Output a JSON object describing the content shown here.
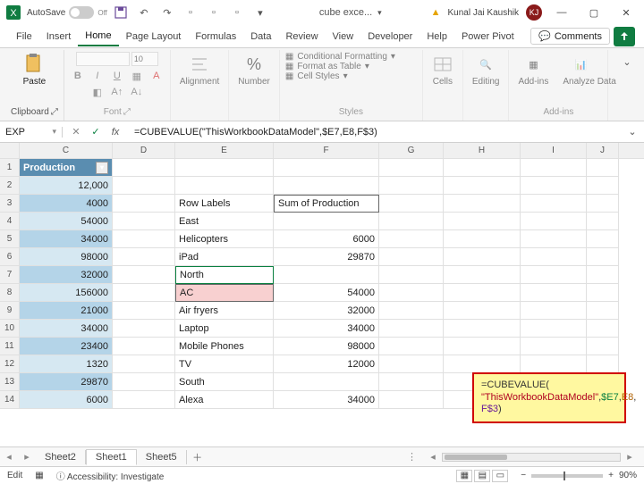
{
  "titlebar": {
    "autosave_label": "AutoSave",
    "autosave_state": "Off",
    "doc_title": "cube exce...",
    "user_name": "Kunal Jai Kaushik",
    "user_initials": "KJ"
  },
  "tabs": {
    "file": "File",
    "insert": "Insert",
    "home": "Home",
    "page_layout": "Page Layout",
    "formulas": "Formulas",
    "data": "Data",
    "review": "Review",
    "view": "View",
    "developer": "Developer",
    "help": "Help",
    "power_pivot": "Power Pivot",
    "comments": "Comments"
  },
  "ribbon": {
    "clipboard": {
      "label": "Clipboard",
      "paste": "Paste"
    },
    "font": {
      "label": "Font",
      "size_hint": "10"
    },
    "alignment": {
      "label": "Alignment"
    },
    "number": {
      "label": "Number"
    },
    "styles": {
      "label": "Styles",
      "cond_format": "Conditional Formatting",
      "format_table": "Format as Table",
      "cell_styles": "Cell Styles"
    },
    "cells": {
      "label": "Cells"
    },
    "editing": {
      "label": "Editing"
    },
    "addins": {
      "group_label": "Add-ins",
      "addins_btn": "Add-ins",
      "analyze": "Analyze Data"
    }
  },
  "fx": {
    "namebox": "EXP",
    "formula": "=CUBEVALUE(\"ThisWorkbookDataModel\",$E7,E8,F$3)"
  },
  "columns": [
    "C",
    "D",
    "E",
    "F",
    "G",
    "H",
    "I",
    "J"
  ],
  "rows": [
    {
      "n": 1,
      "C": {
        "v": "Production",
        "cls": "darkblue",
        "dd": true
      }
    },
    {
      "n": 2,
      "C": {
        "v": "12,000",
        "cls": "altblue r"
      }
    },
    {
      "n": 3,
      "C": {
        "v": "4000",
        "cls": "blue r"
      },
      "E": {
        "v": "Row Labels"
      },
      "F": {
        "v": "Sum of Production",
        "cls": "bordered"
      }
    },
    {
      "n": 4,
      "C": {
        "v": "54000",
        "cls": "altblue r"
      },
      "E": {
        "v": "East"
      }
    },
    {
      "n": 5,
      "C": {
        "v": "34000",
        "cls": "blue r"
      },
      "E": {
        "v": "  Helicopters"
      },
      "F": {
        "v": "6000",
        "cls": "r"
      }
    },
    {
      "n": 6,
      "C": {
        "v": "98000",
        "cls": "altblue r"
      },
      "E": {
        "v": "  iPad"
      },
      "F": {
        "v": "29870",
        "cls": "r"
      }
    },
    {
      "n": 7,
      "C": {
        "v": "32000",
        "cls": "blue r"
      },
      "E": {
        "v": "North",
        "cls": "bordered sel-green"
      }
    },
    {
      "n": 8,
      "C": {
        "v": "156000",
        "cls": "altblue r"
      },
      "E": {
        "v": "  AC",
        "cls": "bordered pink"
      },
      "F": {
        "v": "54000",
        "cls": "r"
      }
    },
    {
      "n": 9,
      "C": {
        "v": "21000",
        "cls": "blue r"
      },
      "E": {
        "v": "  Air fryers"
      },
      "F": {
        "v": "32000",
        "cls": "r"
      }
    },
    {
      "n": 10,
      "C": {
        "v": "34000",
        "cls": "altblue r"
      },
      "E": {
        "v": "  Laptop"
      },
      "F": {
        "v": "34000",
        "cls": "r"
      }
    },
    {
      "n": 11,
      "C": {
        "v": "23400",
        "cls": "blue r"
      },
      "E": {
        "v": "  Mobile Phones"
      },
      "F": {
        "v": "98000",
        "cls": "r"
      }
    },
    {
      "n": 12,
      "C": {
        "v": "1320",
        "cls": "altblue r"
      },
      "E": {
        "v": "  TV"
      },
      "F": {
        "v": "12000",
        "cls": "r"
      }
    },
    {
      "n": 13,
      "C": {
        "v": "29870",
        "cls": "blue r"
      },
      "E": {
        "v": "South"
      }
    },
    {
      "n": 14,
      "C": {
        "v": "6000",
        "cls": "altblue r"
      },
      "E": {
        "v": "  Alexa"
      },
      "F": {
        "v": "34000",
        "cls": "r"
      }
    }
  ],
  "tooltip": {
    "fn": "=CUBEVALUE(",
    "arg1": "\"ThisWorkbookDataModel\"",
    "arg2": "$E7",
    "arg3": "E8",
    "arg4": "F$3",
    "close": ")"
  },
  "sheets": {
    "s2": "Sheet2",
    "s1": "Sheet1",
    "s5": "Sheet5"
  },
  "status": {
    "mode": "Edit",
    "accessibility": "Accessibility: Investigate",
    "zoom": "90%"
  }
}
